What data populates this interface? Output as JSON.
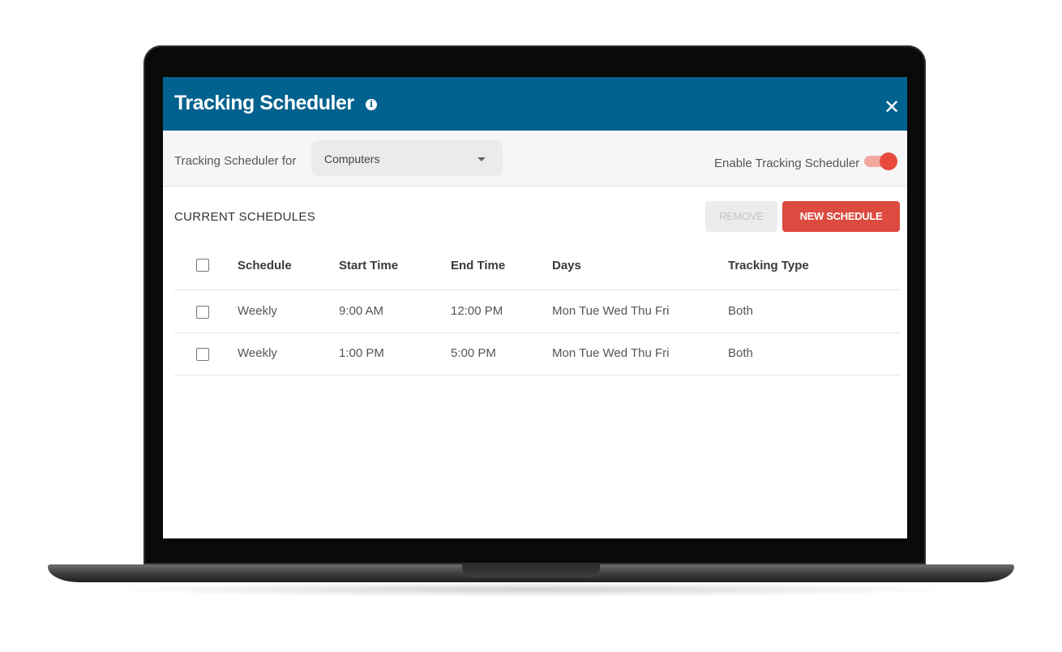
{
  "dialog": {
    "title": "Tracking Scheduler",
    "info_icon": "info-icon",
    "close_icon": "close-icon"
  },
  "filter": {
    "label": "Tracking Scheduler for",
    "select_value": "Computers",
    "enable_label": "Enable Tracking Scheduler",
    "enabled": true
  },
  "schedules": {
    "section_title": "CURRENT SCHEDULES",
    "remove_label": "REMOVE",
    "new_label": "NEW SCHEDULE",
    "columns": [
      "Schedule",
      "Start Time",
      "End Time",
      "Days",
      "Tracking Type"
    ],
    "rows": [
      {
        "schedule": "Weekly",
        "start": "9:00 AM",
        "end": "12:00 PM",
        "days": "Mon Tue Wed Thu Fri",
        "type": "Both"
      },
      {
        "schedule": "Weekly",
        "start": "1:00 PM",
        "end": "5:00 PM",
        "days": "Mon Tue Wed Thu Fri",
        "type": "Both"
      }
    ]
  },
  "colors": {
    "header": "#01618f",
    "accent": "#dc4a40",
    "toggle_on": "#e84a3c"
  }
}
